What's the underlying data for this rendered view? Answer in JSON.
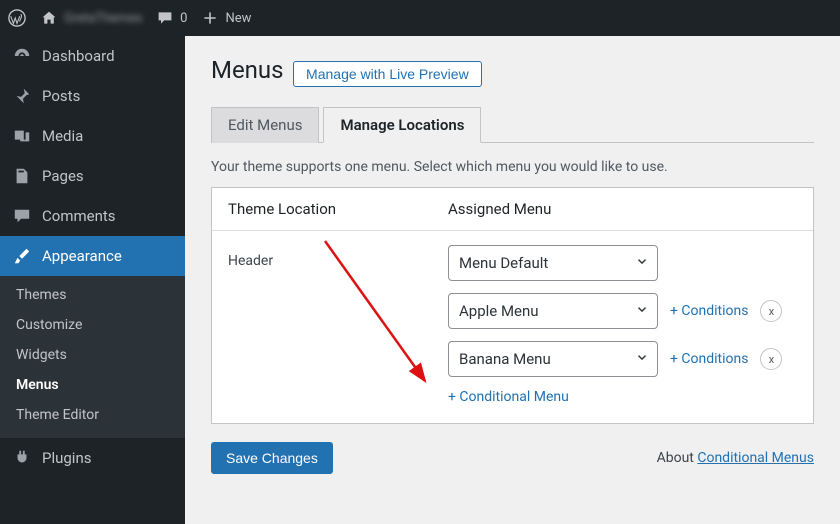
{
  "adminbar": {
    "site_name": "GretaThemes",
    "comment_count": "0",
    "new_label": "New"
  },
  "sidebar": {
    "items": [
      {
        "label": "Dashboard"
      },
      {
        "label": "Posts"
      },
      {
        "label": "Media"
      },
      {
        "label": "Pages"
      },
      {
        "label": "Comments"
      },
      {
        "label": "Appearance"
      },
      {
        "label": "Plugins"
      }
    ],
    "appearance_submenu": [
      {
        "label": "Themes"
      },
      {
        "label": "Customize"
      },
      {
        "label": "Widgets"
      },
      {
        "label": "Menus"
      },
      {
        "label": "Theme Editor"
      }
    ]
  },
  "page": {
    "title": "Menus",
    "live_preview_label": "Manage with Live Preview",
    "tabs": {
      "edit": "Edit Menus",
      "manage": "Manage Locations"
    },
    "help_text": "Your theme supports one menu. Select which menu you would like to use.",
    "columns": {
      "location": "Theme Location",
      "assigned": "Assigned Menu"
    },
    "location_name": "Header",
    "menus": {
      "default": "Menu Default",
      "apple": "Apple Menu",
      "banana": "Banana Menu"
    },
    "conditions_label": "+ Conditions",
    "add_conditional_label": "+ Conditional Menu",
    "remove_label": "x",
    "save_label": "Save Changes",
    "about_prefix": "About ",
    "about_link": "Conditional Menus"
  }
}
